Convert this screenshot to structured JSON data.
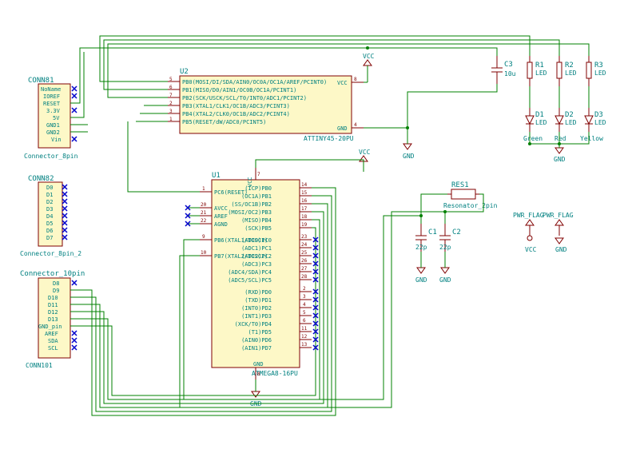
{
  "ic_u2": {
    "ref": "U2",
    "val": "ATTINY45-20PU",
    "pins_left": [
      "PB0(MOSI/DI/SDA/AIN0/OC0A/OC1A/AREF/PCINT0)",
      "PB1(MISO/D0/AIN1/OC0B/OC1A/PCINT1)",
      "PB2(SCK/USCK/SCL/T0/INT0/ADC1/PCINT2)",
      "PB3(XTAL1/CLK1/OC1B/ADC3/PCINT3)",
      "PB4(XTAL2/CLK0/OC1B/ADC2/PCINT4)",
      "PB5(RESET/dW/ADC0/PCINT5)"
    ],
    "pins_right": [
      "VCC",
      "GND"
    ]
  },
  "ic_u1": {
    "ref": "U1",
    "val": "ATMEGA8-16PU",
    "pins_left": [
      {
        "n": "1",
        "t": "PC6(RESET)"
      },
      {
        "n": "20",
        "t": "AVCC"
      },
      {
        "n": "21",
        "t": "AREF"
      },
      {
        "n": "22",
        "t": "AGND"
      },
      {
        "n": "9",
        "t": "PB6(XTAL1/TOSC1)"
      },
      {
        "n": "10",
        "t": "PB7(XTAL2/TOSC2)"
      }
    ],
    "pins_top": {
      "n": "7",
      "t": "VCC"
    },
    "pins_bot": {
      "n": "8",
      "t": "GND"
    },
    "pins_right": [
      {
        "n": "14",
        "t": "(ICP)PB0"
      },
      {
        "n": "15",
        "t": "(OC1A)PB1"
      },
      {
        "n": "16",
        "t": "(SS/OC1B)PB2"
      },
      {
        "n": "17",
        "t": "(MOSI/OC2)PB3"
      },
      {
        "n": "18",
        "t": "(MISO)PB4"
      },
      {
        "n": "19",
        "t": "(SCK)PB5"
      },
      {
        "n": "23",
        "t": "(ADC0)PC0"
      },
      {
        "n": "24",
        "t": "(ADC1)PC1"
      },
      {
        "n": "25",
        "t": "(ADC2)PC2"
      },
      {
        "n": "26",
        "t": "(ADC3)PC3"
      },
      {
        "n": "27",
        "t": "(ADC4/SDA)PC4"
      },
      {
        "n": "28",
        "t": "(ADC5/SCL)PC5"
      },
      {
        "n": "2",
        "t": "(RXD)PD0"
      },
      {
        "n": "3",
        "t": "(TXD)PD1"
      },
      {
        "n": "4",
        "t": "(INT0)PD2"
      },
      {
        "n": "5",
        "t": "(INT1)PD3"
      },
      {
        "n": "6",
        "t": "(XCK/T0)PD4"
      },
      {
        "n": "11",
        "t": "(T1)PD5"
      },
      {
        "n": "12",
        "t": "(AIN0)PD6"
      },
      {
        "n": "13",
        "t": "(AIN1)PD7"
      }
    ]
  },
  "conn81": {
    "ref": "CONN81",
    "name": "Connector_8pin",
    "pins": [
      "NoName",
      "IOREF",
      "RESET",
      "3.3V",
      "5V",
      "GND1",
      "GND2",
      "Vin"
    ]
  },
  "conn82": {
    "ref": "CONN82",
    "name": "Connector_8pin_2",
    "pins": [
      "D0",
      "D1",
      "D2",
      "D3",
      "D4",
      "D5",
      "D6",
      "D7"
    ]
  },
  "conn101": {
    "ref": "CONN101",
    "name": "Connector_10pin",
    "pins": [
      "D8",
      "D9",
      "D10",
      "D11",
      "D12",
      "D13",
      "GND_pin",
      "AREF",
      "SDA",
      "SCL"
    ]
  },
  "caps": {
    "c1": {
      "ref": "C1",
      "val": "22p"
    },
    "c2": {
      "ref": "C2",
      "val": "22p"
    },
    "c3": {
      "ref": "C3",
      "val": "10u"
    }
  },
  "res": {
    "ref": "RES1",
    "val": "Resonator_2pin"
  },
  "leds": {
    "r1": {
      "ref": "R1",
      "val": "LED"
    },
    "r2": {
      "ref": "R2",
      "val": "LED"
    },
    "r3": {
      "ref": "R3",
      "val": "LED"
    },
    "d1": {
      "ref": "D1",
      "val": "LED",
      "c": "Green"
    },
    "d2": {
      "ref": "D2",
      "val": "LED",
      "c": "Red"
    },
    "d3": {
      "ref": "D3",
      "val": "LED",
      "c": "Yellow"
    }
  },
  "pwr": {
    "vcc": "VCC",
    "gnd": "GND",
    "flag": "PWR_FLAG"
  }
}
